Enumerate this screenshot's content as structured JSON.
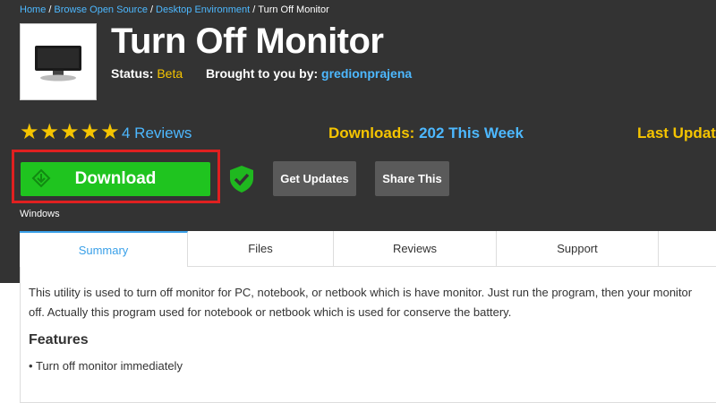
{
  "breadcrumb": [
    {
      "label": "Home",
      "link": true
    },
    {
      "label": "Browse Open Source",
      "link": true
    },
    {
      "label": "Desktop Environment",
      "link": true
    },
    {
      "label": "Turn Off Monitor",
      "link": false
    }
  ],
  "project": {
    "title": "Turn Off Monitor",
    "status_label": "Status:",
    "status_value": "Beta",
    "author_label": "Brought to you by:",
    "author": "gredionprajena"
  },
  "stats": {
    "stars": "★★★★★",
    "rating": 5,
    "reviews": "4 Reviews",
    "downloads_label": "Downloads:",
    "downloads_value": "202 This Week",
    "last_update_label": "Last Update"
  },
  "actions": {
    "download_label": "Download",
    "get_updates_label": "Get Updates",
    "share_label": "Share This",
    "platform": "Windows"
  },
  "tabs": [
    {
      "label": "Summary",
      "active": true
    },
    {
      "label": "Files",
      "active": false
    },
    {
      "label": "Reviews",
      "active": false
    },
    {
      "label": "Support",
      "active": false
    }
  ],
  "summary": {
    "description_line1": "This utility is used to turn off monitor for PC, notebook, or netbook which is have monitor. Just run the program, then your monitor",
    "description_line2": "off. Actually this program used for notebook or netbook which is used for conserve the battery.",
    "features_heading": "Features",
    "features": [
      "Turn off monitor immediately"
    ]
  },
  "colors": {
    "header_bg": "#333333",
    "accent_yellow": "#f5c400",
    "accent_blue": "#4db8ff",
    "download_green": "#1fc41f",
    "highlight_red": "#e02020"
  },
  "icons": [
    "monitor-icon",
    "download-icon",
    "shield-check-icon"
  ]
}
